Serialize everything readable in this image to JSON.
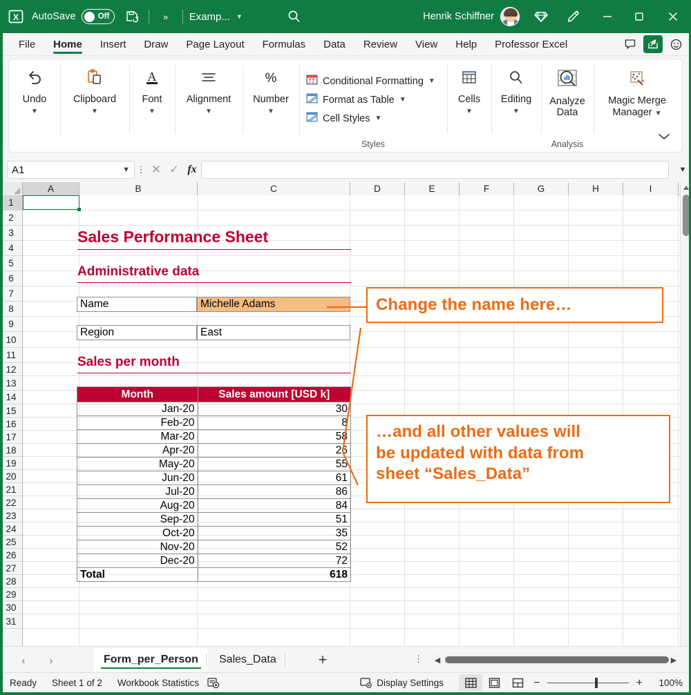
{
  "titlebar": {
    "app_icon": "excel-icon",
    "autosave_label": "AutoSave",
    "autosave_state": "Off",
    "save_icon": "save-icon",
    "overflow_icon": "more-commands-icon",
    "document_name": "Examp...",
    "search_icon": "search-icon",
    "user_name": "Henrik Schiffner",
    "diamond_icon": "diamond-icon",
    "pen_icon": "designer-pen-icon",
    "minimize": "minimize-icon",
    "maximize": "maximize-icon",
    "close": "close-icon",
    "accent_color": "#107c41"
  },
  "ribbon": {
    "tabs": [
      {
        "label": "File",
        "active": false
      },
      {
        "label": "Home",
        "active": true
      },
      {
        "label": "Insert",
        "active": false
      },
      {
        "label": "Draw",
        "active": false
      },
      {
        "label": "Page Layout",
        "active": false
      },
      {
        "label": "Formulas",
        "active": false
      },
      {
        "label": "Data",
        "active": false
      },
      {
        "label": "Review",
        "active": false
      },
      {
        "label": "View",
        "active": false
      },
      {
        "label": "Help",
        "active": false
      },
      {
        "label": "Professor Excel",
        "active": false
      }
    ],
    "right_buttons": [
      {
        "name": "comments-button",
        "icon": "comment-icon"
      },
      {
        "name": "share-button",
        "icon": "share-icon"
      },
      {
        "name": "feedback-button",
        "icon": "smiley-icon"
      }
    ],
    "groups": [
      {
        "label": "Undo",
        "icon": "undo-arrow-icon",
        "caret": true
      },
      {
        "label": "Clipboard",
        "icon": "clipboard-icon",
        "caret": true
      },
      {
        "label": "Font",
        "icon": "font-a-icon",
        "caret": true
      },
      {
        "label": "Alignment",
        "icon": "alignment-lines-icon",
        "caret": true
      },
      {
        "label": "Number",
        "icon": "percent-icon",
        "caret": true
      }
    ],
    "styles": {
      "group_title": "Styles",
      "items": [
        {
          "label": "Conditional Formatting",
          "icon": "conditional-formatting-icon",
          "caret": true
        },
        {
          "label": "Format as Table",
          "icon": "format-as-table-icon",
          "caret": true
        },
        {
          "label": "Cell Styles",
          "icon": "cell-styles-icon",
          "caret": true
        }
      ]
    },
    "cells": {
      "label": "Cells",
      "icon": "cells-table-icon",
      "caret": true
    },
    "editing": {
      "label": "Editing",
      "icon": "magnifier-icon",
      "caret": true
    },
    "analysis": {
      "group_title": "Analysis",
      "label": "Analyze\nData",
      "label_line1": "Analyze",
      "label_line2": "Data",
      "icon": "analyze-data-icon"
    },
    "magic_merge": {
      "label_line1": "Magic Merge",
      "label_line2": "Manager",
      "icon": "magic-merge-icon",
      "caret": true
    },
    "collapse_icon": "chevron-down-icon"
  },
  "formula_bar": {
    "name_box_value": "A1",
    "name_box_caret": "chevron-down-icon",
    "options_icon": "more-options-icon",
    "cancel_icon": "cancel-x-icon",
    "enter_icon": "confirm-check-icon",
    "function_icon": "fx",
    "formula_value": "",
    "expand_icon": "chevron-down-icon"
  },
  "grid": {
    "columns": [
      "A",
      "B",
      "C",
      "D",
      "E",
      "F",
      "G",
      "H",
      "I"
    ],
    "selected_column": "A",
    "selected_row": "1",
    "active_cell": "A1",
    "rows": [
      "1",
      "2",
      "3",
      "4",
      "5",
      "6",
      "7",
      "8",
      "9",
      "10",
      "11",
      "12",
      "13",
      "14",
      "15",
      "16",
      "17",
      "18",
      "19",
      "20",
      "21",
      "22",
      "23",
      "24",
      "25",
      "26",
      "27",
      "28",
      "29",
      "30",
      "31"
    ]
  },
  "sheet_content": {
    "title": "Sales Performance Sheet",
    "section_admin": "Administrative data",
    "fields": [
      {
        "label": "Name",
        "value": "Michelle Adams",
        "highlighted": true
      },
      {
        "label": "Region",
        "value": "East",
        "highlighted": false
      }
    ],
    "section_sales": "Sales per month",
    "table": {
      "headers": [
        "Month",
        "Sales amount [USD k]"
      ],
      "rows": [
        [
          "Jan-20",
          "30"
        ],
        [
          "Feb-20",
          "8"
        ],
        [
          "Mar-20",
          "58"
        ],
        [
          "Apr-20",
          "26"
        ],
        [
          "May-20",
          "55"
        ],
        [
          "Jun-20",
          "61"
        ],
        [
          "Jul-20",
          "86"
        ],
        [
          "Aug-20",
          "84"
        ],
        [
          "Sep-20",
          "51"
        ],
        [
          "Oct-20",
          "35"
        ],
        [
          "Nov-20",
          "52"
        ],
        [
          "Dec-20",
          "72"
        ]
      ],
      "total_label": "Total",
      "total_value": "618"
    },
    "heading_color": "#c00032",
    "header_fill": "#c00032",
    "input_fill": "#f6bd83"
  },
  "annotations": {
    "color": "#ed6b13",
    "callout_1": "Change the name here…",
    "callout_2_line1": "…and all other values will",
    "callout_2_line2": "be updated with data from",
    "callout_2_line3": "sheet “Sales_Data”"
  },
  "sheet_tabs": {
    "prev_icon": "chevron-left-icon",
    "next_icon": "chevron-right-icon",
    "tabs": [
      {
        "label": "Form_per_Person",
        "active": true
      },
      {
        "label": "Sales_Data",
        "active": false
      }
    ],
    "add_label": "+",
    "options_icon": "more-options-icon"
  },
  "status_bar": {
    "state": "Ready",
    "sheet_count": "Sheet 1 of 2",
    "workbook_statistics": "Workbook Statistics",
    "statistics_icon": "statistics-icon",
    "display_settings": "Display Settings",
    "display_settings_icon": "display-settings-icon",
    "views": [
      {
        "name": "normal-view-button",
        "icon": "grid-icon",
        "selected": true
      },
      {
        "name": "page-layout-view-button",
        "icon": "page-layout-icon",
        "selected": false
      },
      {
        "name": "page-break-view-button",
        "icon": "page-break-icon",
        "selected": false
      }
    ],
    "zoom_out": "−",
    "zoom_in": "+",
    "zoom_value": "100%"
  }
}
